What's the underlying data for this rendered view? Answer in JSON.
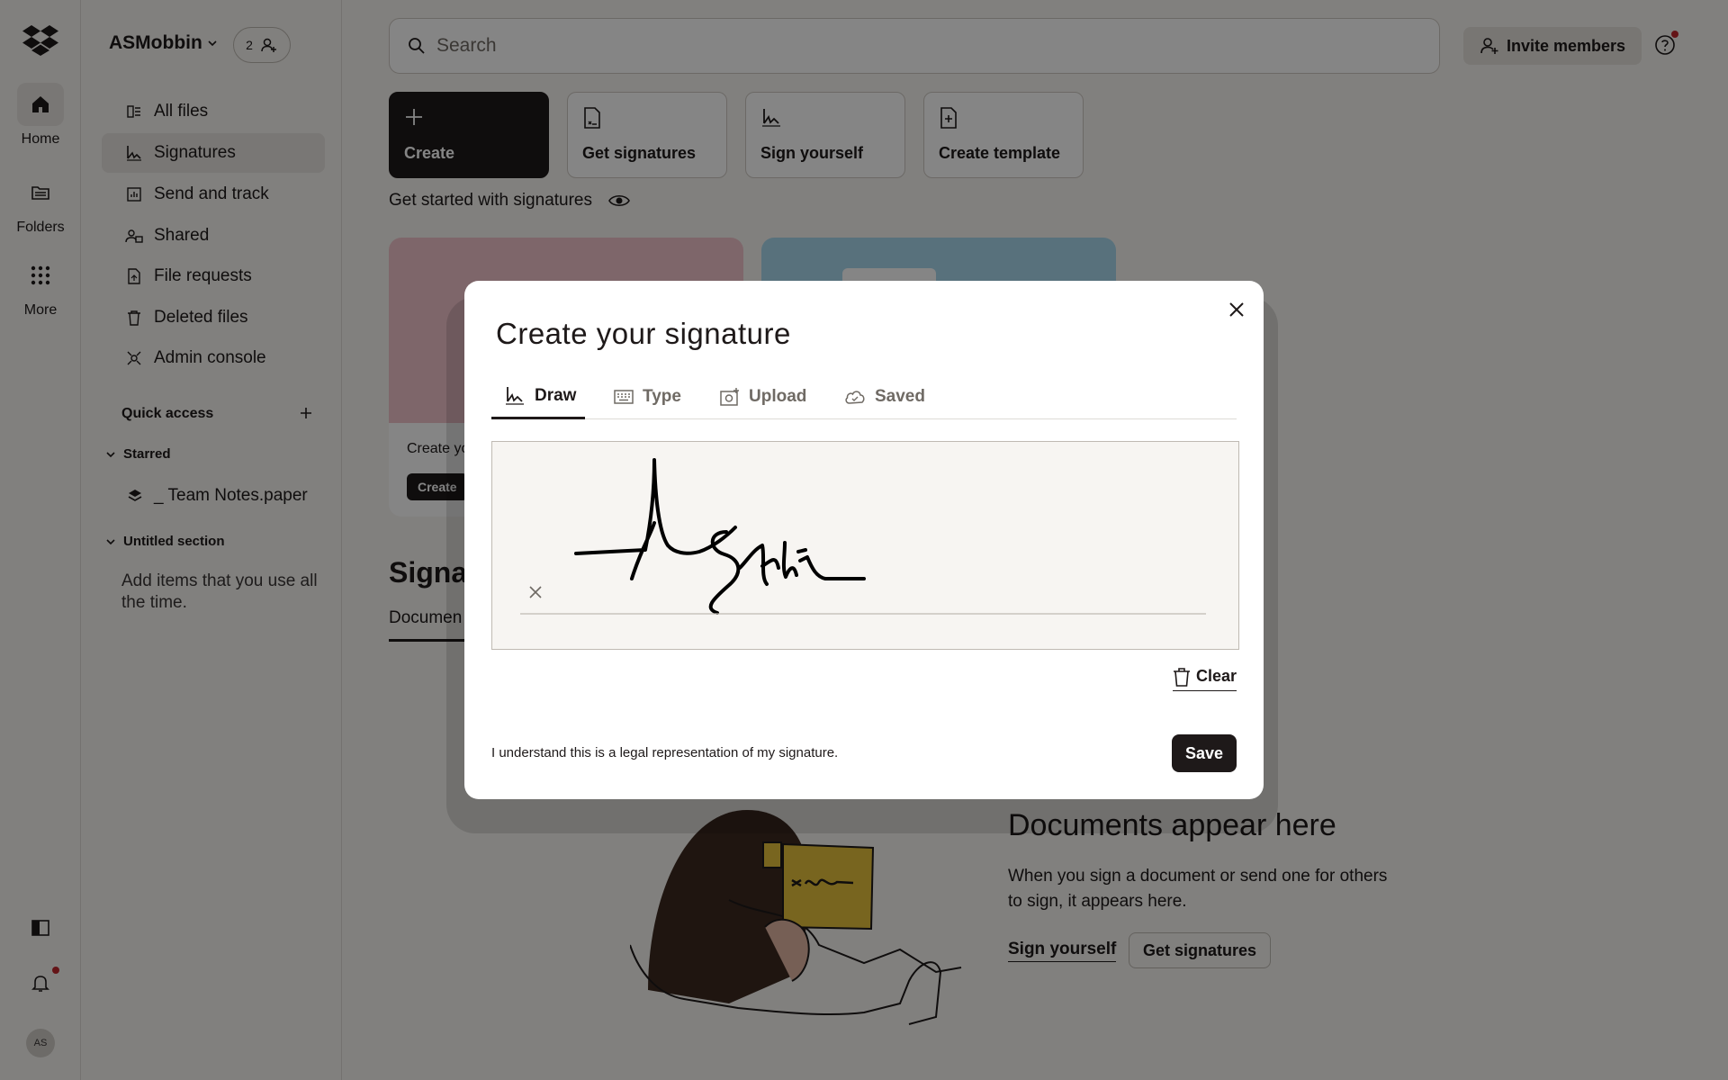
{
  "rail": {
    "items": [
      {
        "label": "Home",
        "icon": "home-icon"
      },
      {
        "label": "Folders",
        "icon": "folder-icon"
      },
      {
        "label": "More",
        "icon": "grid-icon"
      }
    ],
    "avatar_initials": "AS"
  },
  "sidebar": {
    "team_name": "ASMobbin",
    "member_count": "2",
    "items": [
      {
        "label": "All files",
        "icon": "all-files-icon"
      },
      {
        "label": "Signatures",
        "icon": "signature-icon"
      },
      {
        "label": "Send and track",
        "icon": "send-track-icon"
      },
      {
        "label": "Shared",
        "icon": "shared-icon"
      },
      {
        "label": "File requests",
        "icon": "file-request-icon"
      },
      {
        "label": "Deleted files",
        "icon": "trash-icon"
      },
      {
        "label": "Admin console",
        "icon": "admin-icon"
      }
    ],
    "quick_access": "Quick access",
    "starred": "Starred",
    "starred_item": "_ Team Notes.paper",
    "untitled_section": "Untitled section",
    "empty_hint": "Add items that you use all the time."
  },
  "header": {
    "search_placeholder": "Search",
    "invite_label": "Invite members"
  },
  "quick_actions": [
    {
      "label": "Create",
      "icon": "plus-icon"
    },
    {
      "label": "Get signatures",
      "icon": "get-signatures-icon"
    },
    {
      "label": "Sign yourself",
      "icon": "sign-yourself-icon"
    },
    {
      "label": "Create template",
      "icon": "template-icon"
    }
  ],
  "main": {
    "get_started": "Get started with signatures",
    "promo_text": "Create yo",
    "promo_button": "Create",
    "signatures_heading": "Signat",
    "documents_tab": "Documen",
    "empty_title": "Documents appear here",
    "empty_desc": "When you sign a document or send one for others to sign, it appears here.",
    "sign_yourself": "Sign yourself",
    "get_signatures": "Get signatures"
  },
  "modal": {
    "title": "Create your signature",
    "tabs": [
      {
        "label": "Draw",
        "icon": "draw-icon",
        "active": true
      },
      {
        "label": "Type",
        "icon": "keyboard-icon",
        "active": false
      },
      {
        "label": "Upload",
        "icon": "upload-icon",
        "active": false
      },
      {
        "label": "Saved",
        "icon": "cloud-icon",
        "active": false
      }
    ],
    "clear_label": "Clear",
    "legal_text": "I understand this is a legal representation of my signature.",
    "save_label": "Save"
  },
  "colors": {
    "ink": "#1e1919",
    "promo_pink": "#f2c4cb",
    "promo_blue": "#a9d8ee"
  }
}
